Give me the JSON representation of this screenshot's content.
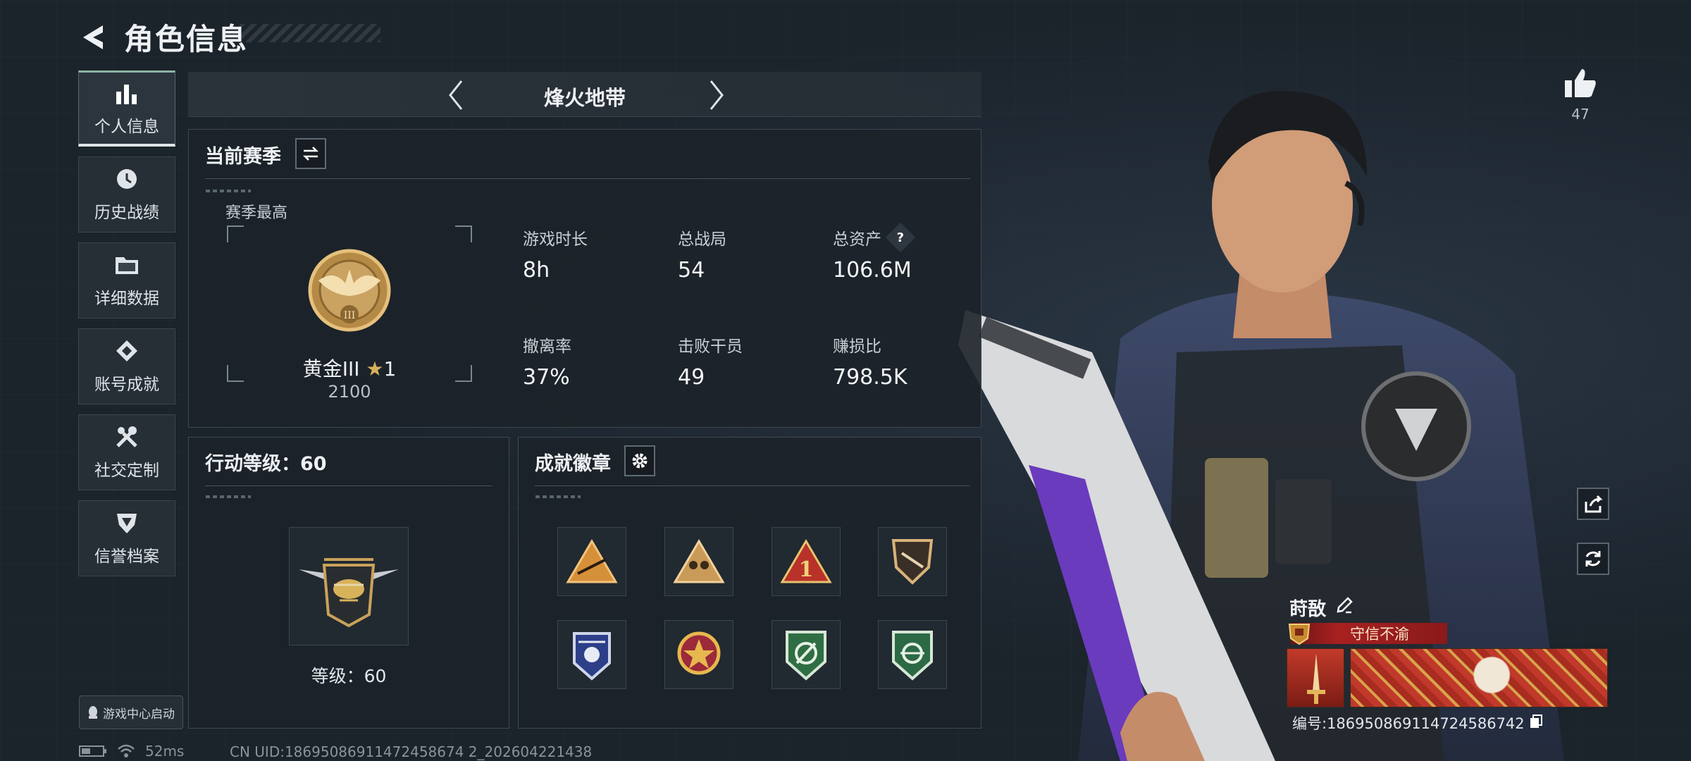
{
  "header": {
    "title": "角色信息"
  },
  "sidebar": {
    "items": [
      {
        "label": "个人信息",
        "icon": "bar-chart-icon",
        "active": true
      },
      {
        "label": "历史战绩",
        "icon": "history-icon",
        "active": false
      },
      {
        "label": "详细数据",
        "icon": "folder-icon",
        "active": false
      },
      {
        "label": "账号成就",
        "icon": "achievement-icon",
        "active": false
      },
      {
        "label": "社交定制",
        "icon": "tools-icon",
        "active": false
      },
      {
        "label": "信誉档案",
        "icon": "shield-icon",
        "active": false
      }
    ]
  },
  "launch_button": {
    "label": "游戏中心启动"
  },
  "footer": {
    "ping": "52ms",
    "uid": "CN UID:18695086911472458674 2_202604221438"
  },
  "mode": {
    "name": "烽火地带"
  },
  "season": {
    "title": "当前赛季",
    "subtitle": "赛季最高",
    "rank_name": "黄金III",
    "rank_stars": "1",
    "rank_score": "2100",
    "stats": [
      {
        "key": "游戏时长",
        "value": "8h"
      },
      {
        "key": "总战局",
        "value": "54"
      },
      {
        "key": "总资产",
        "value": "106.6M",
        "help": "?"
      },
      {
        "key": "撤离率",
        "value": "37%"
      },
      {
        "key": "击败干员",
        "value": "49"
      },
      {
        "key": "赚损比",
        "value": "798.5K"
      }
    ]
  },
  "action_level": {
    "title": "行动等级：60",
    "label": "等级：60"
  },
  "badges": {
    "title": "成就徽章"
  },
  "like": {
    "count": "47"
  },
  "player": {
    "name": "莳敔",
    "title": "守信不渝",
    "serial": "编号:186950869114724586742"
  },
  "colors": {
    "background": "#1b232b",
    "panel": "#1c2229",
    "accent_green": "#8fb3a3",
    "title_red": "#a82020",
    "gold": "#c9a25a"
  }
}
